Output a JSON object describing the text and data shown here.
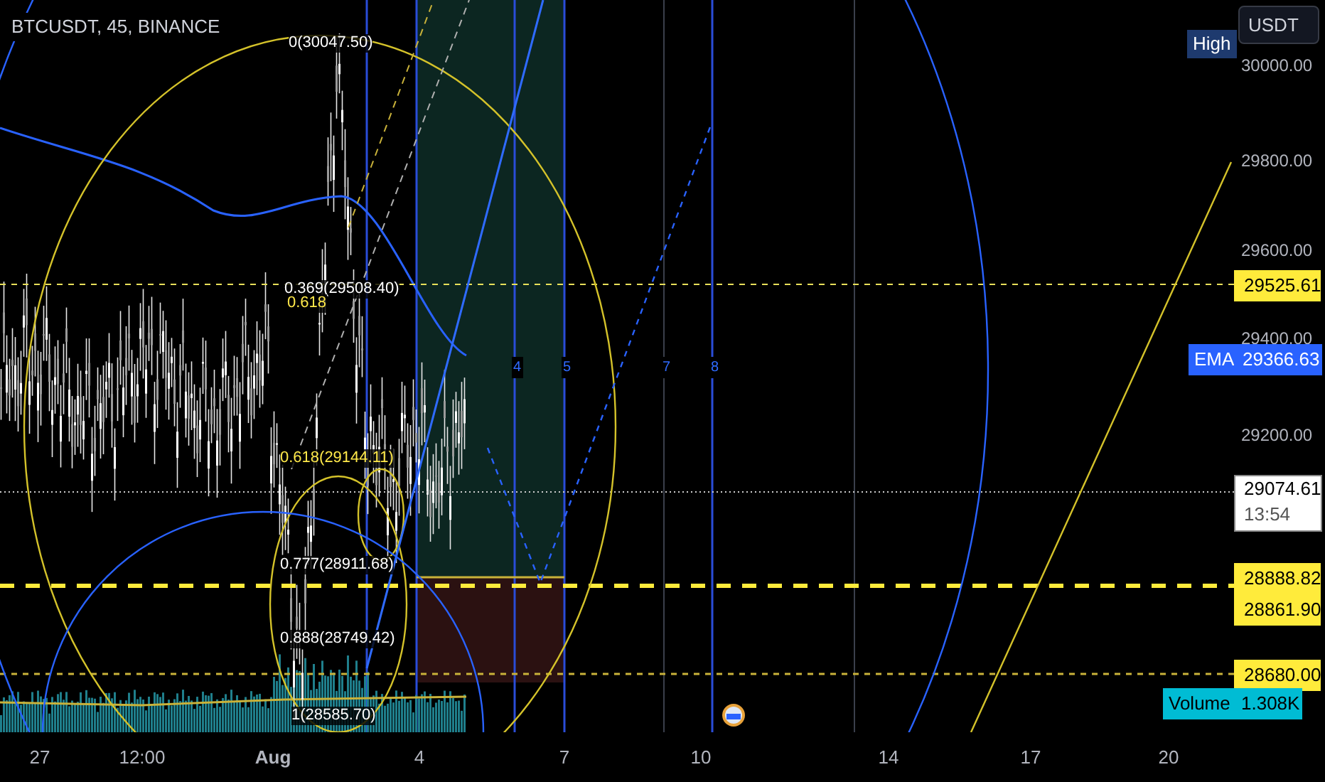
{
  "symbol_title": "BTCUSDT, 45, BINANCE",
  "currency_button": {
    "label": "USDT"
  },
  "price_ticks": [
    "30000.00",
    "29800.00",
    "29600.00",
    "29400.00",
    "29200.00"
  ],
  "price_badges": [
    {
      "kind": "high",
      "label": "High"
    },
    {
      "kind": "level",
      "value": "29525.61"
    },
    {
      "kind": "ema",
      "label": "EMA",
      "value": "29366.63"
    },
    {
      "kind": "last",
      "value": "29074.61",
      "countdown": "13:54"
    },
    {
      "kind": "level",
      "value": "28888.82"
    },
    {
      "kind": "level",
      "value": "28861.90"
    },
    {
      "kind": "level",
      "value": "28680.00"
    },
    {
      "kind": "volume",
      "label": "Volume",
      "value": "1.308K"
    }
  ],
  "fib_labels": [
    {
      "kind": "white",
      "text": "0(30047.50)"
    },
    {
      "kind": "white",
      "text": "0.369(29508.40)"
    },
    {
      "kind": "yellow",
      "text": "0.618"
    },
    {
      "kind": "yellow",
      "text": "0.618(29144.11)"
    },
    {
      "kind": "white",
      "text": "0.777(28911.68)"
    },
    {
      "kind": "white",
      "text": "0.888(28749.42)"
    },
    {
      "kind": "white",
      "text": "1(28585.70)"
    }
  ],
  "cycle_numbers": [
    "4",
    "5",
    "7",
    "8"
  ],
  "time_ticks": [
    {
      "text": "27",
      "bold": false
    },
    {
      "text": "12:00",
      "bold": false
    },
    {
      "text": "Aug",
      "bold": true
    },
    {
      "text": "4",
      "bold": false
    },
    {
      "text": "7",
      "bold": false
    },
    {
      "text": "10",
      "bold": false
    },
    {
      "text": "14",
      "bold": false
    },
    {
      "text": "17",
      "bold": false
    },
    {
      "text": "20",
      "bold": false
    }
  ]
}
